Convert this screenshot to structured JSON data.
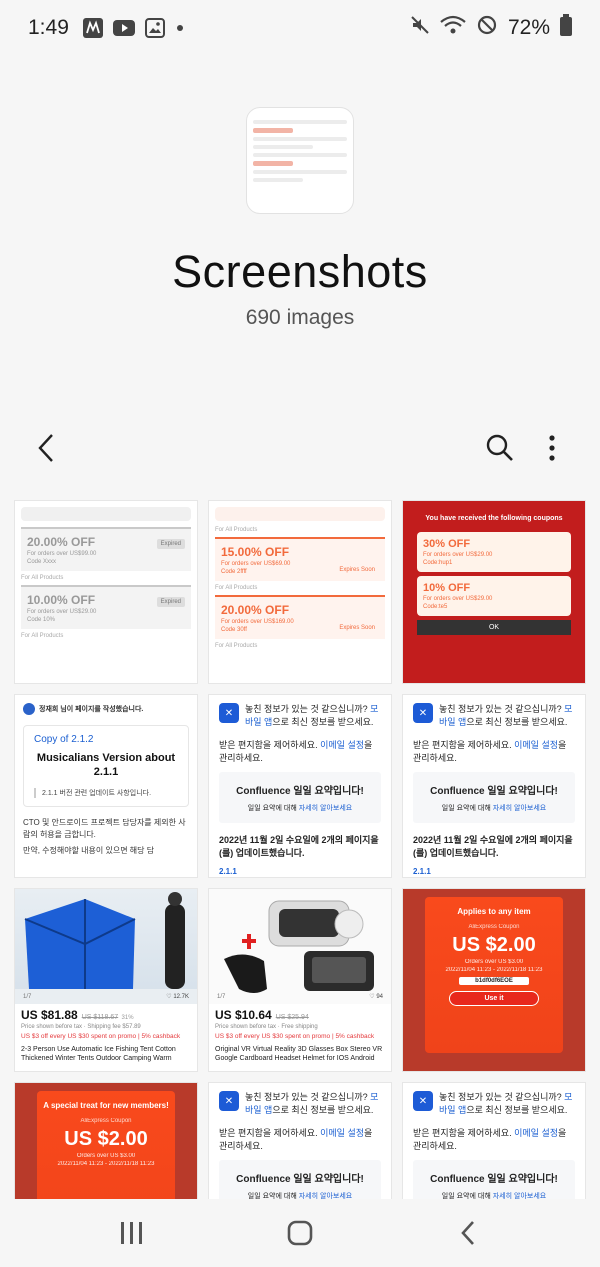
{
  "status_bar": {
    "time": "1:49",
    "battery": "72%",
    "icons": [
      "mc-donalds-icon",
      "youtube-icon",
      "gallery-icon",
      "dot-icon",
      "mute-icon",
      "wifi-icon",
      "dnd-icon",
      "battery-icon"
    ]
  },
  "album": {
    "title": "Screenshots",
    "count": "690 images"
  },
  "toolbar": {
    "back_icon": "chevron-left-icon",
    "search_icon": "search-icon",
    "more_icon": "more-vertical-icon"
  },
  "tiles": {
    "t1": {
      "coupons": [
        {
          "pct": "20.00% OFF",
          "line1": "For orders over US$99.00",
          "line2": "Code Xxxx",
          "button": "Expired"
        },
        {
          "pct": "10.00% OFF",
          "line1": "For orders over US$29.00",
          "line2": "Code 10%",
          "button": "Expired"
        }
      ],
      "meta": "For All Products"
    },
    "t2": {
      "coupons": [
        {
          "pct": "15.00% OFF",
          "line1": "For orders over US$69.00",
          "line2": "Code 2ffff",
          "button": "Expires Soon"
        },
        {
          "pct": "20.00% OFF",
          "line1": "For orders over US$169.00",
          "line2": "Code 30ff",
          "button": "Expires Soon"
        }
      ],
      "meta": "For All Products"
    },
    "t3": {
      "head": "You have received the following coupons",
      "cards": [
        {
          "pct": "30% OFF",
          "line1": "For orders over US$29.00",
          "line2": "Code:hup1"
        },
        {
          "pct": "10% OFF",
          "line1": "For orders over US$29.00",
          "line2": "Code:te5"
        }
      ],
      "ok": "OK"
    },
    "t4": {
      "notice": "정재희 님이 페이지를 작성했습니다.",
      "copy": "Copy of 2.1.2",
      "heading": "Musicalians Version about 2.1.1",
      "quote": "2.1.1 버전 관련 업데이트 사항입니다.",
      "body1": "CTO 및 안드로이드 프로젝트 담당자를 제외한 사람의 허용을 금합니다.",
      "body2": "만약, 수정해야할 내용이 있으면 해당 담"
    },
    "conf": {
      "line1a": "놓친 정보가 있는 것 같으십니까?",
      "line1b": "모바일 앱",
      "line1c": "으로 최신 정보를 받으세요.",
      "line2a": "받은 편지함을 제어하세요.",
      "line2b": "이메일 설정",
      "line2c": "을 관리하세요.",
      "box_title": "Confluence 일일 요약입니다!",
      "box_sub_a": "일일 요약에 대해",
      "box_sub_b": "자세히 알아보세요",
      "date": "2022년 11월 2일 수요일에 2개의 페이지을(를) 업데이트했습니다.",
      "version": "2.1.1"
    },
    "p1": {
      "counter": "1/7",
      "likes": "12.7K",
      "price": "US $81.88",
      "old_price": "US $118.67",
      "discount": "31%",
      "shipping": "Price shown before tax · Shipping fee $57.89",
      "promo": "US $3 off every US $30 spent on promo  |  5% cashback",
      "title": "2-3 Person Use Automatic Ice Fishing Tent Cotton Thickened Winter Tents Outdoor Camping Warm"
    },
    "p2": {
      "counter": "1/7",
      "likes": "94",
      "price": "US $10.64",
      "old_price": "US $25.94",
      "shipping": "Price shown before tax · Free shipping",
      "promo": "US $3 off every US $30 spent on promo  |  5% cashback",
      "title": "Original VR Virtual Reality 3D Glasses Box Stereo VR Google Cardboard Headset Helmet for IOS Android"
    },
    "c1": {
      "head": "Applies to any item",
      "sub": "AliExpress Coupon",
      "amount": "US $2.00",
      "small": "Orders over US $3.00",
      "dates": "2022/11/04 11:23 - 2022/11/18 11:23",
      "code": "b1df0df6EOE",
      "use": "Use it"
    },
    "c2": {
      "head": "A special treat for new members!",
      "sub": "AliExpress Coupon",
      "amount": "US $2.00",
      "small": "Orders over US $3.00",
      "dates": "2022/11/04 11:23 - 2022/11/18 11:23"
    }
  },
  "navbar": {
    "recents_icon": "recents-icon",
    "home_icon": "home-icon",
    "back_icon": "back-icon"
  }
}
